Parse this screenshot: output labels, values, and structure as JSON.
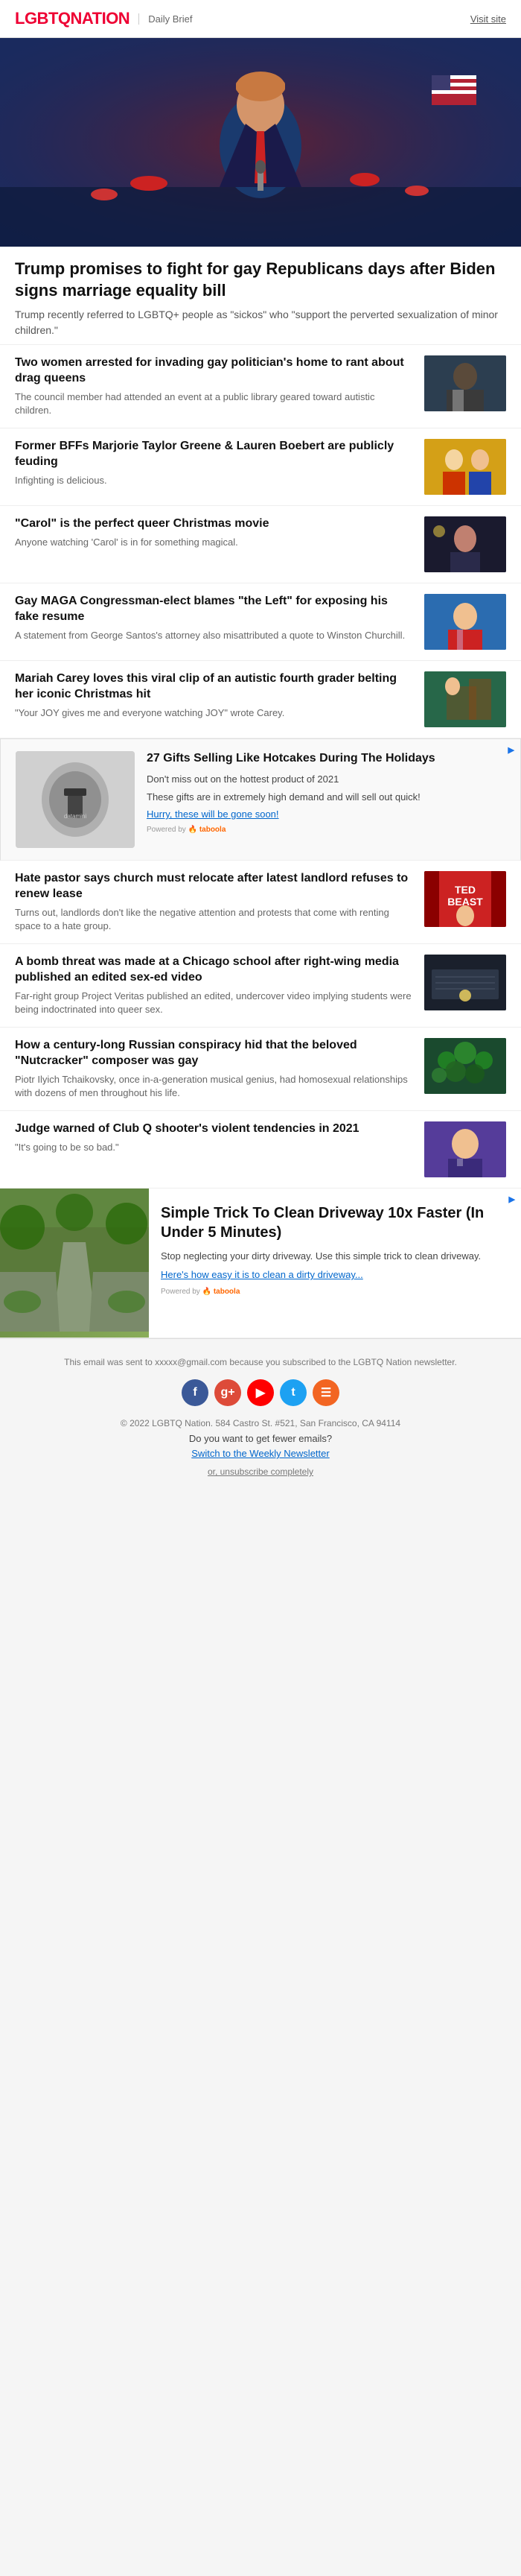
{
  "header": {
    "logo": "LGBTQ",
    "logo_nation": "NATION",
    "tagline": "Daily Brief",
    "visit_site": "Visit site"
  },
  "hero": {
    "image_alt": "Trump at rally",
    "title": "Trump promises to fight for gay Republicans days after Biden signs marriage equality bill",
    "description": "Trump recently referred to LGBTQ+ people as \"sickos\" who \"support the perverted sexualization of minor children.\""
  },
  "articles": [
    {
      "title": "Two women arrested for invading gay politician's home to rant about drag queens",
      "description": "The council member had attended an event at a public library geared toward autistic children.",
      "thumb_label": "👨",
      "thumb_class": "thumb-1"
    },
    {
      "title": "Former BFFs Marjorie Taylor Greene & Lauren Boebert are publicly feuding",
      "description": "Infighting is delicious.",
      "thumb_label": "👩",
      "thumb_class": "thumb-2"
    },
    {
      "title": "\"Carol\" is the perfect queer Christmas movie",
      "description": "Anyone watching 'Carol' is in for something magical.",
      "thumb_label": "🎬",
      "thumb_class": "thumb-3"
    },
    {
      "title": "Gay MAGA Congressman-elect blames \"the Left\" for exposing his fake resume",
      "description": "A statement from George Santos's attorney also misattributed a quote to Winston Churchill.",
      "thumb_label": "😊",
      "thumb_class": "thumb-4"
    },
    {
      "title": "Mariah Carey loves this viral clip of an autistic fourth grader belting her iconic Christmas hit",
      "description": "\"Your JOY gives me and everyone watching JOY\" wrote Carey.",
      "thumb_label": "🎤",
      "thumb_class": "thumb-5"
    },
    {
      "title": "Hate pastor says church must relocate after latest landlord refuses to renew lease",
      "description": "Turns out, landlords don't like the negative attention and protests that come with renting space to a hate group.",
      "thumb_label": "⛪",
      "thumb_class": "thumb-6"
    },
    {
      "title": "A bomb threat was made at a Chicago school after right-wing media published an edited sex-ed video",
      "description": "Far-right group Project Veritas published an edited, undercover video implying students were being indoctrinated into queer sex.",
      "thumb_label": "🏫",
      "thumb_class": "thumb-7"
    },
    {
      "title": "How a century-long Russian conspiracy hid that the beloved \"Nutcracker\" composer was gay",
      "description": "Piotr Ilyich Tchaikovsky, once in-a-generation musical genius, had homosexual relationships with dozens of men throughout his life.",
      "thumb_label": "🎵",
      "thumb_class": "thumb-8"
    },
    {
      "title": "Judge warned of Club Q shooter's violent tendencies in 2021",
      "description": "\"It's going to be so bad.\"",
      "thumb_label": "⚖️",
      "thumb_class": "thumb-9"
    }
  ],
  "ad1": {
    "title": "27 Gifts Selling Like Hotcakes During The Holidays",
    "desc1": "Don't miss out on the hottest product of 2021",
    "desc2": "These gifts are in extremely high demand and will sell out quick!",
    "cta": "Hurry, these will be gone soon!",
    "powered": "Powered by"
  },
  "ad2": {
    "title": "Simple Trick To Clean Driveway 10x Faster (In Under 5 Minutes)",
    "desc": "Stop neglecting your dirty driveway. Use this simple trick to clean driveway.",
    "cta": "Here's how easy it is to clean a dirty driveway...",
    "powered": "Powered by"
  },
  "footer": {
    "email_notice": "This email was sent to xxxxx@gmail.com because you subscribed to the LGBTQ Nation newsletter.",
    "copyright": "© 2022 LGBTQ Nation. 584 Castro St. #521, San Francisco, CA 94114",
    "fewer_emails": "Do you want to get fewer emails?",
    "switch_label": "Switch to the Weekly Newsletter",
    "unsub": "or, unsubscribe completely"
  }
}
